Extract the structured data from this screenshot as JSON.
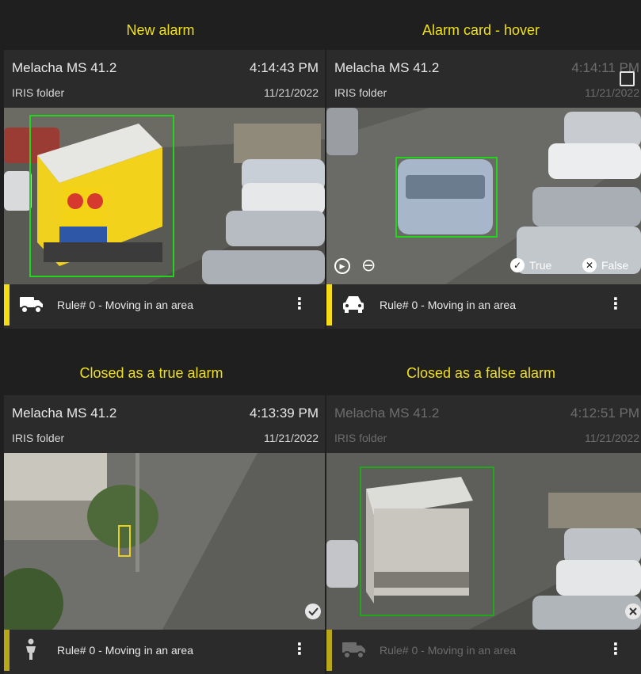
{
  "sections": {
    "new_alarm": "New alarm",
    "hover": "Alarm card - hover",
    "closed_true": "Closed as a true alarm",
    "closed_false": "Closed as a false alarm"
  },
  "cards": [
    {
      "camera": "Melacha MS 41.2",
      "time": "4:14:43 PM",
      "folder": "IRIS folder",
      "date": "11/21/2022",
      "rule": "Rule# 0 - Moving in an area",
      "object_icon": "truck-icon"
    },
    {
      "camera": "Melacha MS 41.2",
      "time": "4:14:11 PM",
      "folder": "IRIS folder",
      "date": "11/21/2022",
      "rule": "Rule# 0 - Moving in an area",
      "object_icon": "car-icon"
    },
    {
      "camera": "Melacha MS 41.2",
      "time": "4:13:39 PM",
      "folder": "IRIS folder",
      "date": "11/21/2022",
      "rule": "Rule# 0 - Moving in an area",
      "object_icon": "person-icon"
    },
    {
      "camera": "Melacha MS 41.2",
      "time": "4:12:51 PM",
      "folder": "IRIS folder",
      "date": "11/21/2022",
      "rule": "Rule# 0 - Moving in an area",
      "object_icon": "truck-icon"
    }
  ],
  "hover_controls": {
    "true_label": "True",
    "false_label": "False"
  },
  "kebab": "⋮",
  "colors": {
    "accent_yellow": "#f5dc14",
    "accent_dim": "#b8a817",
    "detection_green": "#22d41a",
    "detection_yellow": "#e6d21a"
  }
}
